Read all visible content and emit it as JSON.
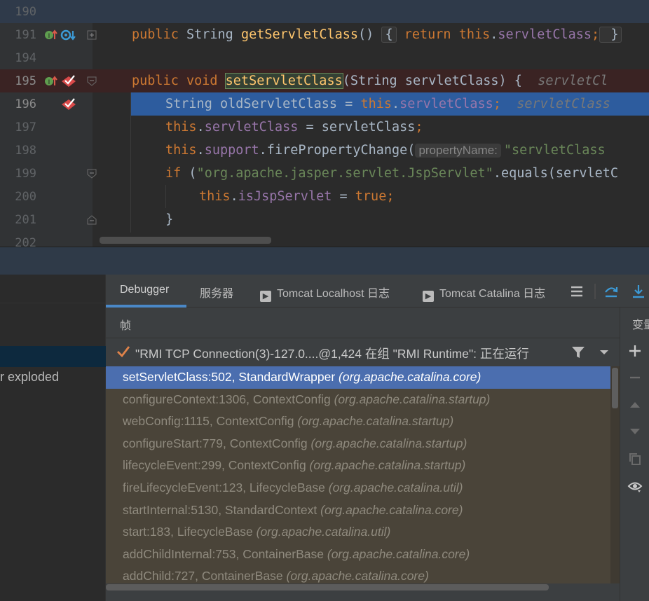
{
  "editor": {
    "lines": [
      {
        "num": "190"
      },
      {
        "num": "191",
        "c1": "public",
        "c2": " String ",
        "c3": "getServletClass",
        "c4": "() ",
        "c5": "{",
        "c6": " return ",
        "c7": "this",
        "c8": ".",
        "c9": "servletClass",
        "c10": ";",
        "c11": " }"
      },
      {
        "num": "194"
      },
      {
        "num": "195",
        "c1": "public void ",
        "c2": "setServletClass",
        "c3": "(String servletClass) {  ",
        "c4": "servletCl"
      },
      {
        "num": "196",
        "c1": "String oldServletClass = ",
        "c2": "this",
        "c3": ".",
        "c4": "servletClass",
        "c5": ";",
        "c6": "  servletClass"
      },
      {
        "num": "197",
        "c1": "this",
        "c2": ".",
        "c3": "servletClass",
        "c4": " = servletClass",
        "c5": ";"
      },
      {
        "num": "198",
        "c1": "this",
        "c2": ".",
        "c3": "support",
        "c4": ".firePropertyChange(",
        "c5": "propertyName:",
        "c6": "\"servletClass"
      },
      {
        "num": "199",
        "c1": "if",
        "c2": " (",
        "c3": "\"org.apache.jasper.servlet.JspServlet\"",
        "c4": ".equals(servletC"
      },
      {
        "num": "200",
        "c1": "this",
        "c2": ".",
        "c3": "isJspServlet",
        "c4": " = ",
        "c5": "true",
        "c6": ";"
      },
      {
        "num": "201",
        "c1": "}"
      },
      {
        "num": "202"
      }
    ]
  },
  "left_panel": {
    "item_text": "r exploded"
  },
  "debugger": {
    "tabs": [
      {
        "label": "Debugger"
      },
      {
        "label": "服务器"
      },
      {
        "label": "Tomcat Localhost 日志"
      },
      {
        "label": "Tomcat Catalina 日志"
      }
    ],
    "frames_title": "帧",
    "variables_title": "变量",
    "thread": "\"RMI TCP Connection(3)-127.0....@1,424 在组 \"RMI Runtime\": 正在运行",
    "frames": [
      {
        "method": "setServletClass:502, StandardWrapper",
        "pkg": "(org.apache.catalina.core)"
      },
      {
        "method": "configureContext:1306, ContextConfig",
        "pkg": "(org.apache.catalina.startup)"
      },
      {
        "method": "webConfig:1115, ContextConfig",
        "pkg": "(org.apache.catalina.startup)"
      },
      {
        "method": "configureStart:779, ContextConfig",
        "pkg": "(org.apache.catalina.startup)"
      },
      {
        "method": "lifecycleEvent:299, ContextConfig",
        "pkg": "(org.apache.catalina.startup)"
      },
      {
        "method": "fireLifecycleEvent:123, LifecycleBase",
        "pkg": "(org.apache.catalina.util)"
      },
      {
        "method": "startInternal:5130, StandardContext",
        "pkg": "(org.apache.catalina.core)"
      },
      {
        "method": "start:183, LifecycleBase",
        "pkg": "(org.apache.catalina.util)"
      },
      {
        "method": "addChildInternal:753, ContainerBase",
        "pkg": "(org.apache.catalina.core)"
      },
      {
        "method": "addChild:727, ContainerBase",
        "pkg": "(org.apache.catalina.core)"
      }
    ],
    "icons": {
      "toolbar": [
        "list-icon",
        "step-over-icon",
        "step-into-icon"
      ],
      "side": [
        "plus-icon",
        "minus-icon",
        "up-icon",
        "down-icon",
        "copy-icon",
        "eye-icon"
      ]
    }
  },
  "colors": {
    "keyword": "#cc7832",
    "method": "#ffc66d",
    "field": "#9876aa",
    "string": "#6a8759",
    "selected_frame": "#4b6eaf",
    "exec_line": "#2d5c9e"
  }
}
